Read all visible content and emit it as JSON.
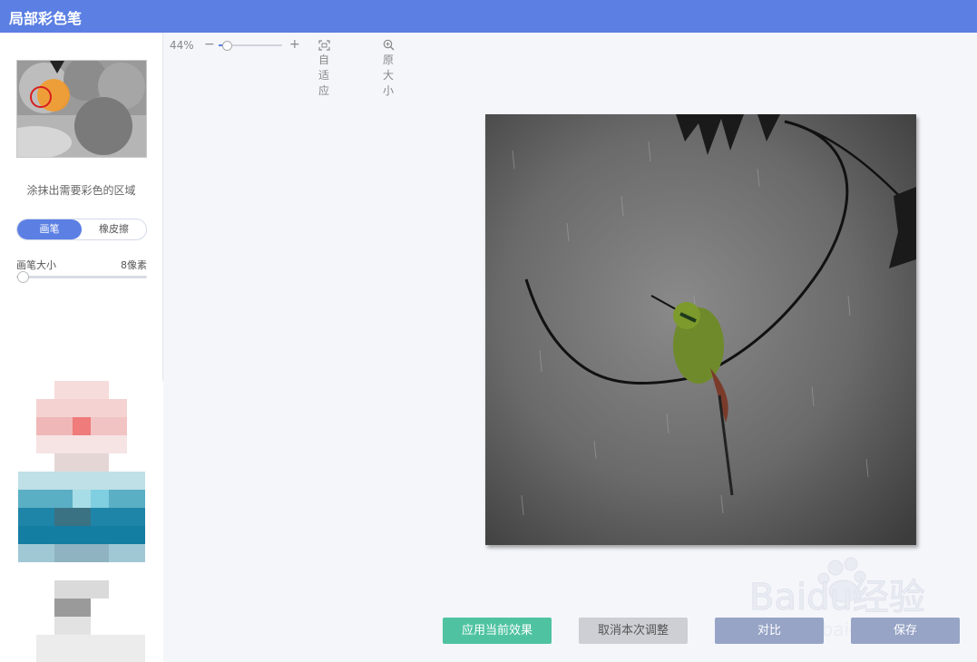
{
  "window": {
    "title": "局部彩色笔"
  },
  "sidebar": {
    "hint": "涂抹出需要彩色的区域",
    "tools": {
      "brush": "画笔",
      "eraser": "橡皮擦"
    },
    "brush_size": {
      "label": "画笔大小",
      "value": "8像素",
      "level": 0.0
    }
  },
  "toolbar": {
    "zoom": "44%",
    "minus_symbol": "−",
    "plus_symbol": "+",
    "fit": "自适应",
    "original": "原大小"
  },
  "actions": {
    "apply": "应用当前效果",
    "cancel": "取消本次调整",
    "compare": "对比",
    "save": "保存"
  },
  "watermark": {
    "brand": "Baidu经验",
    "url": "jingyan.baidu.com"
  },
  "colors": {
    "accent": "#5b7fe3",
    "apply": "#4fc3a1",
    "muted": "#97a4c6"
  },
  "icons": [
    "fit-icon",
    "magnifier-icon",
    "pointer-triangle-icon"
  ]
}
